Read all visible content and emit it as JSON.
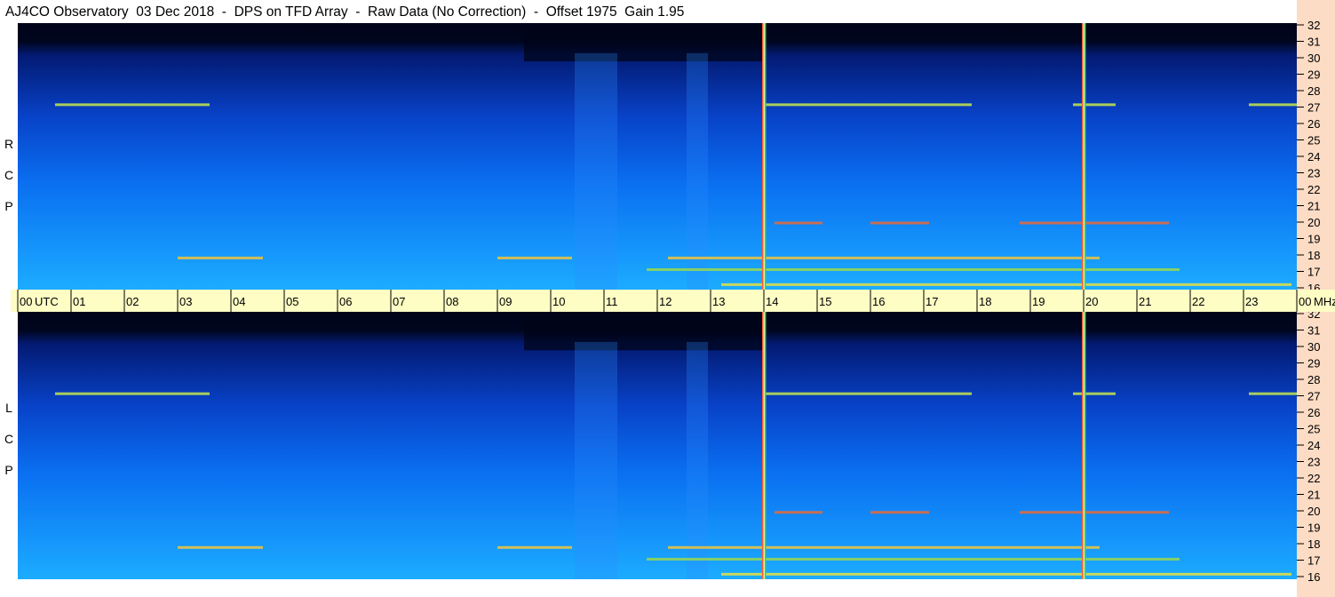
{
  "title": "AJ4CO Observatory  03 Dec 2018  -  DPS on TFD Array  -  Raw Data (No Correction)  -  Offset 1975  Gain 1.95",
  "panels": [
    {
      "id": "rcp",
      "label": [
        "R",
        "C",
        "P"
      ]
    },
    {
      "id": "lcp",
      "label": [
        "L",
        "C",
        "P"
      ]
    }
  ],
  "time_axis": {
    "ticks": [
      "00",
      "01",
      "02",
      "03",
      "04",
      "05",
      "06",
      "07",
      "08",
      "09",
      "10",
      "11",
      "12",
      "13",
      "14",
      "15",
      "16",
      "17",
      "18",
      "19",
      "20",
      "21",
      "22",
      "23",
      "00"
    ],
    "unit_left": "UTC",
    "unit_right": "MHz"
  },
  "freq_axis": {
    "ticks": [
      "32",
      "31",
      "30",
      "29",
      "28",
      "27",
      "26",
      "25",
      "24",
      "23",
      "22",
      "21",
      "20",
      "19",
      "18",
      "17",
      "16"
    ]
  },
  "colors": {
    "background_dark": "#000830",
    "band_blue": "#0a4fd8",
    "band_light": "#1aa2ff",
    "freq_scale_bg": "#fcdcc4",
    "time_scale_bg": "#fdfdc4"
  },
  "chart_data": {
    "type": "heatmap",
    "x_range_utc_hours": [
      0,
      24
    ],
    "y_range_mhz": [
      16,
      32
    ],
    "series": [
      {
        "name": "R C P"
      },
      {
        "name": "L C P"
      }
    ],
    "vertical_markers_utc": [
      14.0,
      20.0
    ],
    "bright_bands_mhz": [
      27.1,
      20.0,
      17.9,
      17.2,
      16.3
    ]
  }
}
